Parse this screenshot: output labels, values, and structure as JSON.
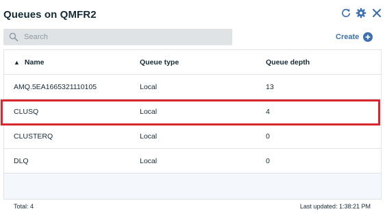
{
  "window": {
    "title": "Queues on QMFR2"
  },
  "header_icons": {
    "refresh": "refresh-icon",
    "settings": "gear-icon",
    "close": "close-icon"
  },
  "search": {
    "placeholder": "Search",
    "value": ""
  },
  "create": {
    "label": "Create",
    "icon": "add-circle-icon"
  },
  "table": {
    "columns": [
      "Name",
      "Queue type",
      "Queue depth"
    ],
    "sort": {
      "column": "Name",
      "direction": "ascending"
    },
    "rows": [
      {
        "name": "AMQ.5EA1665321110105",
        "type": "Local",
        "depth": "13"
      },
      {
        "name": "CLUSQ",
        "type": "Local",
        "depth": "4",
        "highlighted": true
      },
      {
        "name": "CLUSTERQ",
        "type": "Local",
        "depth": "0"
      },
      {
        "name": "DLQ",
        "type": "Local",
        "depth": "0"
      }
    ]
  },
  "footer": {
    "total": "Total: 4",
    "last_updated": "Last updated: 1:38:21 PM"
  },
  "colors": {
    "accent": "#3d70b2",
    "highlight": "#d8262e",
    "text": "#152935",
    "search_bg": "#dfe3e6"
  }
}
